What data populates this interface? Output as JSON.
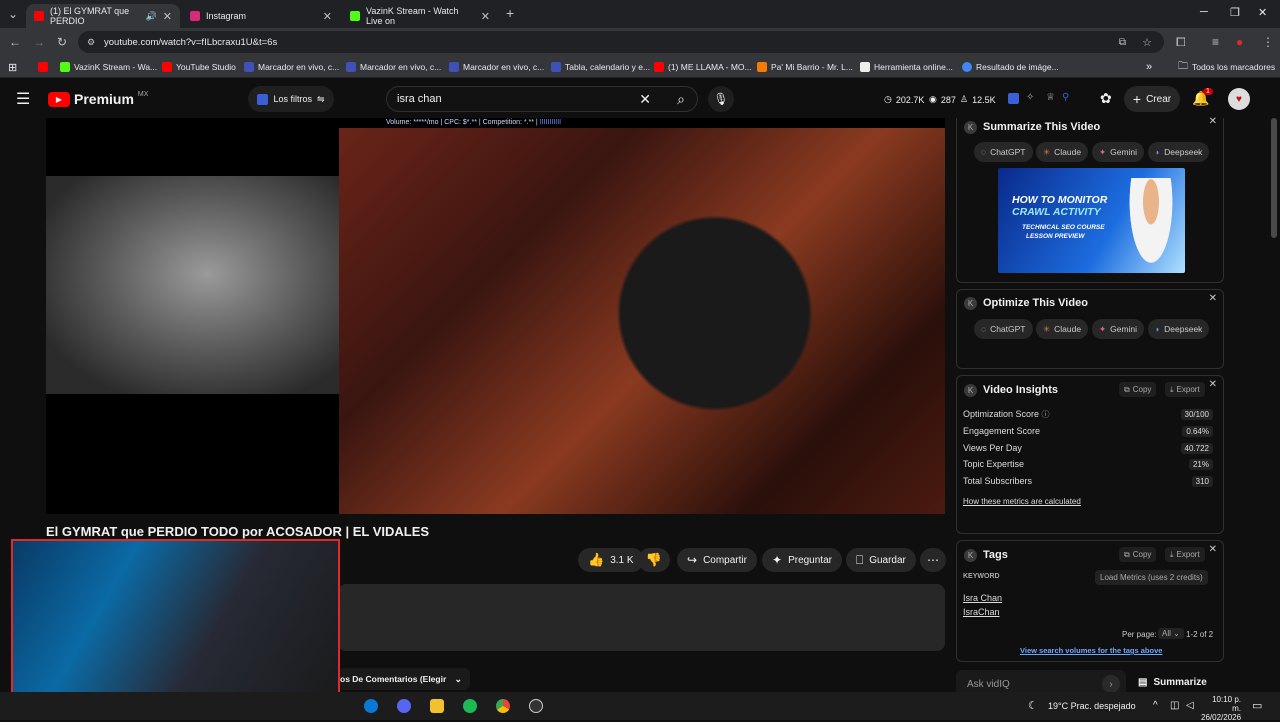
{
  "tabs": [
    {
      "title": "(1) El GYMRAT que PERDIO",
      "color": "#ff0000"
    },
    {
      "title": "Instagram",
      "color": "#d62976"
    },
    {
      "title": "VazinK Stream - Watch Live on",
      "color": "#53fc18"
    }
  ],
  "url": "youtube.com/watch?v=fILbcraxu1U&t=6s",
  "bookmarks": [
    "VazinK Stream - Wa...",
    "YouTube Studio",
    "Marcador en vivo, c...",
    "Marcador en vivo, c...",
    "Marcador en vivo, c...",
    "Tabla, calendario y e...",
    "(1) ME LLAMA - MO...",
    "Pa' Mi Barrio - Mr. L...",
    "Herramienta online...",
    "Resultado de imáge..."
  ],
  "bookmarks_all": "Todos los marcadores",
  "yt": {
    "logo": "Premium",
    "region": "MX",
    "filters": "Los filtros",
    "search_query": "isra chan",
    "stats": [
      "202.7K",
      "287",
      "12.5K"
    ],
    "create": "Crear",
    "notif_count": "1"
  },
  "video": {
    "volume_bar": "Volume: *****/mo | CPC: $*.** | Competition: *.** |",
    "title": "El GYMRAT que PERDIO TODO por ACOSADOR | EL VIDALES",
    "likes": "3.1 K",
    "share": "Compartir",
    "ask": "Preguntar",
    "save": "Guardar",
    "comments_sort": "os De Comentarios (Elegir"
  },
  "panels": {
    "summarize": {
      "title": "Summarize This Video",
      "ai": [
        "ChatGPT",
        "Claude",
        "Gemini",
        "Deepseek"
      ],
      "ad_line1": "HOW TO MONITOR",
      "ad_line2": "CRAWL ACTIVITY",
      "ad_line3": "TECHNICAL SEO COURSE",
      "ad_line4": "LESSON PREVIEW"
    },
    "optimize": {
      "title": "Optimize This Video",
      "ai": [
        "ChatGPT",
        "Claude",
        "Gemini",
        "Deepseek"
      ]
    },
    "insights": {
      "title": "Video Insights",
      "copy": "Copy",
      "export": "Export",
      "metrics": [
        {
          "label": "Optimization Score",
          "value": "30/100"
        },
        {
          "label": "Engagement Score",
          "value": "0.64%"
        },
        {
          "label": "Views Per Day",
          "value": "40.722"
        },
        {
          "label": "Topic Expertise",
          "value": "21%"
        },
        {
          "label": "Total Subscribers",
          "value": "310"
        }
      ],
      "link": "How these metrics are calculated"
    },
    "tags": {
      "title": "Tags",
      "copy": "Copy",
      "export": "Export",
      "keyword_header": "KEYWORD",
      "load_metrics": "Load Metrics (uses 2 credits)",
      "items": [
        "Isra Chan",
        "IsraChan"
      ],
      "per_page_label": "Per page:",
      "per_page_value": "All",
      "range": "1-2 of 2",
      "link": "View search volumes for the tags above"
    },
    "ask": {
      "placeholder": "Ask vidIQ",
      "summarize": "Summarize"
    }
  },
  "taskbar": {
    "weather": "19°C  Prac. despejado",
    "time": "10:10 p. m.",
    "date": "26/02/2026"
  }
}
